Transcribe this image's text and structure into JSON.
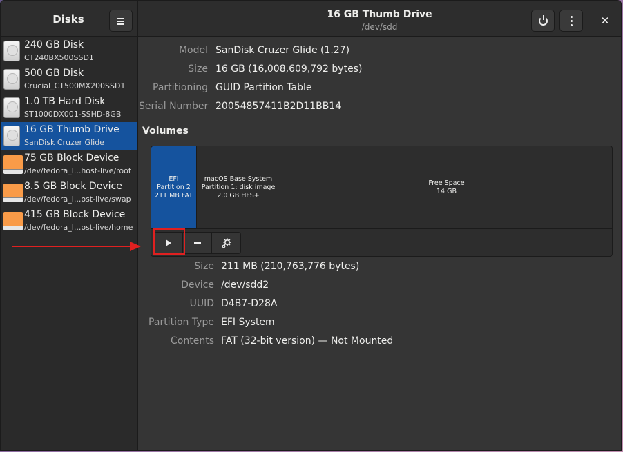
{
  "sidebar": {
    "title": "Disks",
    "menu_icon": "hamburger-menu-icon",
    "drives": [
      {
        "name": "240 GB Disk",
        "sub": "CT240BX500SSD1",
        "icon": "hard-disk-icon",
        "selected": false
      },
      {
        "name": "500 GB Disk",
        "sub": "Crucial_CT500MX200SSD1",
        "icon": "hard-disk-icon",
        "selected": false
      },
      {
        "name": "1.0 TB Hard Disk",
        "sub": "ST1000DX001-SSHD-8GB",
        "icon": "hard-disk-icon",
        "selected": false
      },
      {
        "name": "16 GB Thumb Drive",
        "sub": "SanDisk Cruzer Glide",
        "icon": "hard-disk-icon",
        "selected": true
      },
      {
        "name": "75 GB Block Device",
        "sub": "/dev/fedora_l...host-live/root",
        "icon": "block-device-icon",
        "selected": false
      },
      {
        "name": "8.5 GB Block Device",
        "sub": "/dev/fedora_l...ost-live/swap",
        "icon": "block-device-icon",
        "selected": false
      },
      {
        "name": "415 GB Block Device",
        "sub": "/dev/fedora_l...ost-live/home",
        "icon": "block-device-icon",
        "selected": false
      }
    ]
  },
  "header": {
    "title": "16 GB Thumb Drive",
    "subtitle": "/dev/sdd",
    "close_label": "✕"
  },
  "drive_info": [
    {
      "key": "Model",
      "value": "SanDisk Cruzer Glide (1.27)"
    },
    {
      "key": "Size",
      "value": "16 GB (16,008,609,792 bytes)"
    },
    {
      "key": "Partitioning",
      "value": "GUID Partition Table"
    },
    {
      "key": "Serial Number",
      "value": "20054857411B2D11BB14"
    }
  ],
  "volumes": {
    "title": "Volumes",
    "partitions": [
      {
        "lines": [
          "EFI",
          "Partition 2",
          "211 MB FAT"
        ],
        "selected": true
      },
      {
        "lines": [
          "macOS Base System",
          "Partition 1: disk image",
          "2.0 GB HFS+"
        ],
        "selected": false
      },
      {
        "lines": [
          "Free Space",
          "14 GB"
        ],
        "selected": false
      }
    ],
    "toolbar": [
      "play-icon",
      "minus-icon",
      "gears-icon"
    ]
  },
  "partition_info": [
    {
      "key": "Size",
      "value": "211 MB (210,763,776 bytes)"
    },
    {
      "key": "Device",
      "value": "/dev/sdd2"
    },
    {
      "key": "UUID",
      "value": "D4B7-D28A"
    },
    {
      "key": "Partition Type",
      "value": "EFI System"
    },
    {
      "key": "Contents",
      "value": "FAT (32-bit version) — Not Mounted"
    }
  ],
  "annotation_color": "#e02020",
  "accent_color": "#15539e"
}
